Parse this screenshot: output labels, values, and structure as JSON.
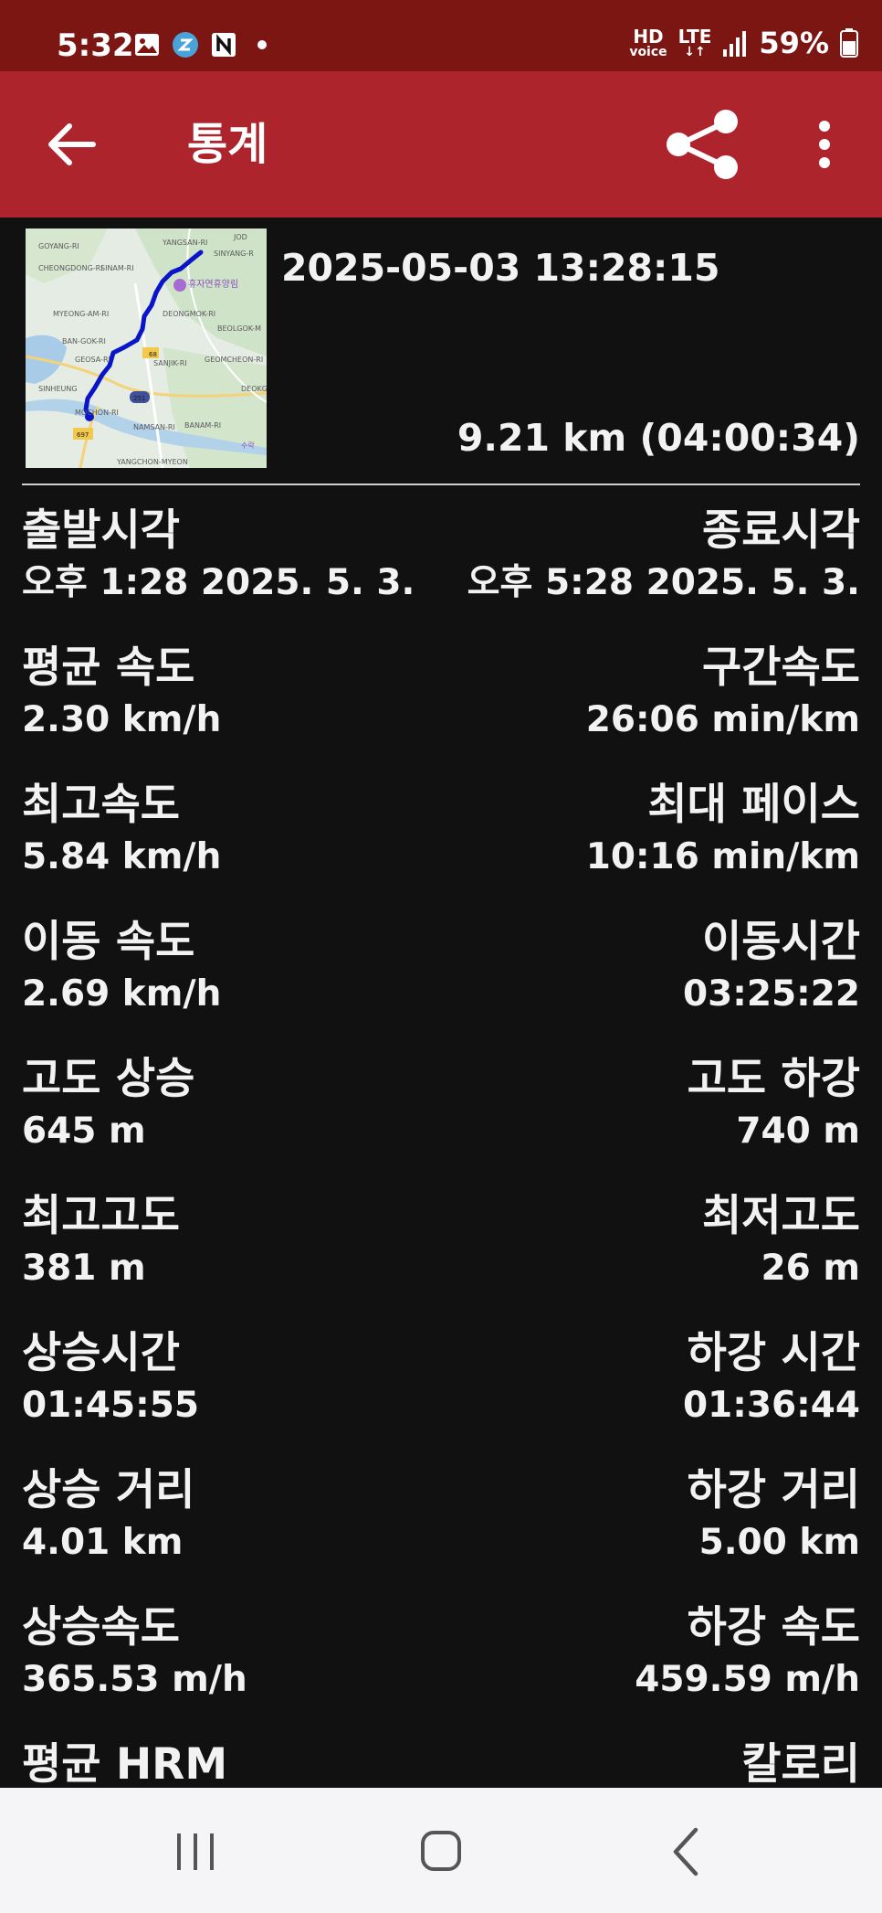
{
  "status_bar": {
    "time": "5:32",
    "hd_top": "HD",
    "hd_bottom": "voice",
    "lte": "LTE",
    "battery": "59%",
    "notification_icons": [
      "gallery-icon",
      "samsung-s-icon",
      "naver-n-icon"
    ]
  },
  "app_bar": {
    "title": "통계"
  },
  "track": {
    "date": "2025-05-03 13:28:15",
    "summary": "9.21 km (04:00:34)"
  },
  "map_labels": [
    {
      "name": "map-label-goyang",
      "text": "GOYANG-RI"
    },
    {
      "name": "map-label-yangsan",
      "text": "YANGSAN-RI"
    },
    {
      "name": "map-label-jodong",
      "text": "JOD"
    },
    {
      "name": "map-label-cheongdong",
      "text": "CHEONGDONG-RI"
    },
    {
      "name": "map-label-sinam",
      "text": "SINAM-RI"
    },
    {
      "name": "map-label-sinyang",
      "text": "SINYANG-R"
    },
    {
      "name": "map-label-myeongam",
      "text": "MYEONG-AM-RI"
    },
    {
      "name": "map-label-deongmok",
      "text": "DEONGMOK-RI"
    },
    {
      "name": "map-label-beolgok",
      "text": "BEOLGOK-M"
    },
    {
      "name": "map-label-bangok",
      "text": "BAN-GOK-RI"
    },
    {
      "name": "map-label-geosa",
      "text": "GEOSA-RI"
    },
    {
      "name": "map-label-sanjik",
      "text": "SANJIK-RI"
    },
    {
      "name": "map-label-geomcheon",
      "text": "GEOMCHEON-RI"
    },
    {
      "name": "map-label-sinheung",
      "text": "SINHEUNG"
    },
    {
      "name": "map-label-deok",
      "text": "DEOKG"
    },
    {
      "name": "map-label-mochon",
      "text": "MOCHON-RI"
    },
    {
      "name": "map-label-namsan",
      "text": "NAMSAN-RI"
    },
    {
      "name": "map-label-banam",
      "text": "BANAM-RI"
    },
    {
      "name": "map-label-yangchon",
      "text": "YANGCHON-MYEON"
    },
    {
      "name": "map-label-suryeok",
      "text": "수락"
    },
    {
      "name": "map-label-poi",
      "text": "휴자연휴양림"
    },
    {
      "name": "map-road-68",
      "text": "68"
    },
    {
      "name": "map-road-251",
      "text": "251"
    },
    {
      "name": "map-road-697",
      "text": "697"
    }
  ],
  "stats": [
    {
      "left_label": "출발시각",
      "left_value": "오후 1:28 2025. 5. 3.",
      "right_label": "종료시각",
      "right_value": "오후 5:28 2025. 5. 3."
    },
    {
      "left_label": "평균 속도",
      "left_value": "2.30 km/h",
      "right_label": "구간속도",
      "right_value": "26:06 min/km"
    },
    {
      "left_label": "최고속도",
      "left_value": "5.84 km/h",
      "right_label": "최대 페이스",
      "right_value": "10:16 min/km"
    },
    {
      "left_label": "이동 속도",
      "left_value": "2.69 km/h",
      "right_label": "이동시간",
      "right_value": "03:25:22"
    },
    {
      "left_label": "고도 상승",
      "left_value": "645 m",
      "right_label": "고도 하강",
      "right_value": "740 m"
    },
    {
      "left_label": "최고고도",
      "left_value": "381 m",
      "right_label": "최저고도",
      "right_value": "26 m"
    },
    {
      "left_label": "상승시간",
      "left_value": "01:45:55",
      "right_label": "하강 시간",
      "right_value": "01:36:44"
    },
    {
      "left_label": "상승 거리",
      "left_value": "4.01 km",
      "right_label": "하강 거리",
      "right_value": "5.00 km"
    },
    {
      "left_label": "상승속도",
      "left_value": "365.53 m/h",
      "right_label": "하강 속도",
      "right_value": "459.59 m/h"
    },
    {
      "left_label": "평균 HRM",
      "left_value": "",
      "right_label": "칼로리",
      "right_value": ""
    }
  ],
  "colors": {
    "status_bar": "#7b1612",
    "app_bar": "#ad242d",
    "background": "#111111",
    "text": "#f2f2f2",
    "track_line": "#0a14c8",
    "nav_bar": "#f5f5f7"
  }
}
